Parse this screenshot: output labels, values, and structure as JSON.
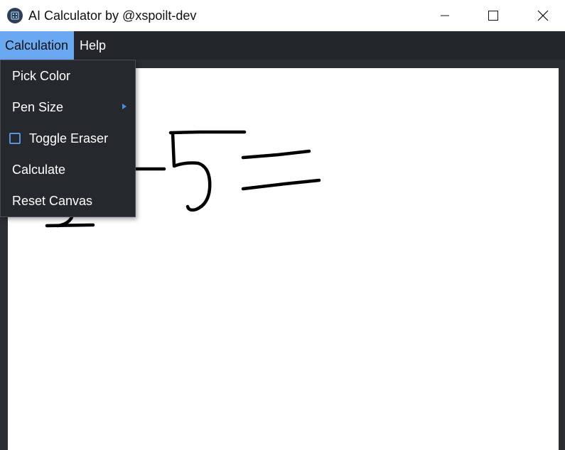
{
  "window": {
    "title": "AI Calculator by @xspoilt-dev"
  },
  "menubar": {
    "calculation": "Calculation",
    "help": "Help"
  },
  "dropdown": {
    "pick_color": "Pick Color",
    "pen_size": "Pen Size",
    "toggle_eraser": "Toggle Eraser",
    "toggle_eraser_checked": false,
    "calculate": "Calculate",
    "reset_canvas": "Reset Canvas"
  },
  "colors": {
    "accent": "#6aa9f2",
    "menubar_bg": "#23262a",
    "dropdown_bg": "#25282c",
    "ink": "#000000"
  },
  "icons": {
    "app": "calculator-icon",
    "minimize": "minimize-icon",
    "maximize": "maximize-icon",
    "close": "close-icon",
    "submenu": "chevron-right-icon"
  }
}
